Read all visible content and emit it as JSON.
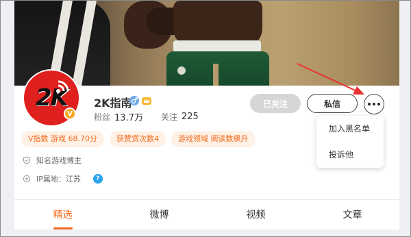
{
  "profile": {
    "name": "2K指南",
    "avatar_text": "2K",
    "verified_badge": "V",
    "fans_label": "粉丝",
    "fans_count": "13.7万",
    "following_label": "关注",
    "following_count": "225"
  },
  "actions": {
    "followed_label": "已关注",
    "message_label": "私信"
  },
  "menu": {
    "items": [
      {
        "label": "加入黑名单"
      },
      {
        "label": "投诉他"
      }
    ]
  },
  "tags": [
    {
      "label": "V指数 游戏 68.70分"
    },
    {
      "label": "获赞赏次数4"
    },
    {
      "label": "游戏领域 阅读数飙升"
    }
  ],
  "info": {
    "verification": "知名游戏博主",
    "ip_location": "IP属地：江苏",
    "help_icon": "?"
  },
  "tabs": [
    {
      "label": "精选"
    },
    {
      "label": "微博"
    },
    {
      "label": "视频"
    },
    {
      "label": "文章"
    }
  ],
  "colors": {
    "accent": "#f26a1a",
    "avatar_red": "#e01f1f",
    "arrow_red": "#e8322f"
  }
}
